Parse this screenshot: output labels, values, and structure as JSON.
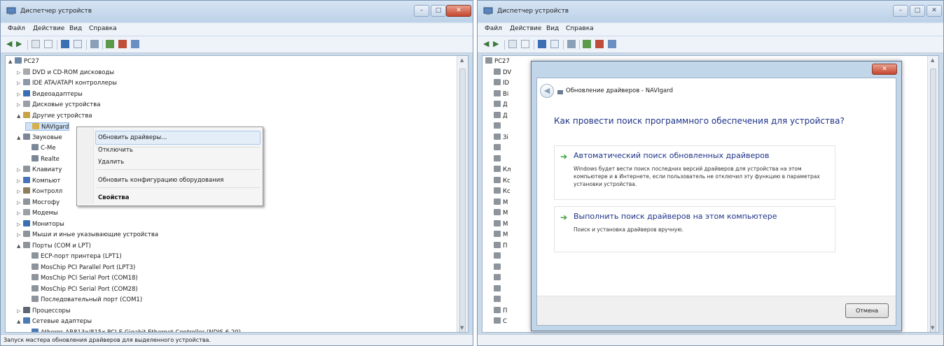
{
  "left_window": {
    "title": "Диспетчер устройств",
    "menu": [
      "Файл",
      "Действие",
      "Вид",
      "Справка"
    ],
    "status_text": "Запуск мастера обновления драйверов для выделенного устройства.",
    "tree": [
      {
        "label": "PC27",
        "level": 0,
        "expander": "▲",
        "icon_color": "#6c87a8"
      },
      {
        "label": "DVD и CD-ROM дисководы",
        "level": 1,
        "expander": "▷",
        "icon_color": "#a7a9ac"
      },
      {
        "label": "IDE ATA/ATAPI контроллеры",
        "level": 1,
        "expander": "▷",
        "icon_color": "#8c98a6"
      },
      {
        "label": "Видеоадаптеры",
        "level": 1,
        "expander": "▷",
        "icon_color": "#3b6fb4"
      },
      {
        "label": "Дисковые устройства",
        "level": 1,
        "expander": "▷",
        "icon_color": "#9a9fa6"
      },
      {
        "label": "Другие устройства",
        "level": 1,
        "expander": "▲",
        "icon_color": "#c9a24a"
      },
      {
        "label": "NAVIgard",
        "level": 2,
        "expander": "",
        "icon_color": "#d6b04b"
      },
      {
        "label": "Звуковые",
        "level": 1,
        "expander": "▲",
        "icon_color": "#7b8796"
      },
      {
        "label": "C-Me",
        "level": 2,
        "expander": "",
        "icon_color": "#7b8796"
      },
      {
        "label": "Realte",
        "level": 2,
        "expander": "",
        "icon_color": "#7b8796"
      },
      {
        "label": "Клавиату",
        "level": 1,
        "expander": "▷",
        "icon_color": "#8e949b"
      },
      {
        "label": "Компьют",
        "level": 1,
        "expander": "▷",
        "icon_color": "#4873b8"
      },
      {
        "label": "Контролл",
        "level": 1,
        "expander": "▷",
        "icon_color": "#8e7d5e"
      },
      {
        "label": "Мосгофу",
        "level": 1,
        "expander": "▷",
        "icon_color": "#8e949b"
      },
      {
        "label": "Модемы",
        "level": 1,
        "expander": "▷",
        "icon_color": "#9aa0a7"
      },
      {
        "label": "Мониторы",
        "level": 1,
        "expander": "▷",
        "icon_color": "#3b6fb4"
      },
      {
        "label": "Мыши и иные указывающие устройства",
        "level": 1,
        "expander": "▷",
        "icon_color": "#8e949b"
      },
      {
        "label": "Порты (COM и LPT)",
        "level": 1,
        "expander": "▲",
        "icon_color": "#8e949b"
      },
      {
        "label": "ECP-порт принтера (LPT1)",
        "level": 2,
        "expander": "",
        "icon_color": "#8e949b"
      },
      {
        "label": "MosChip PCI Parallel Port (LPT3)",
        "level": 2,
        "expander": "",
        "icon_color": "#8e949b"
      },
      {
        "label": "MosChip PCI Serial Port (COM18)",
        "level": 2,
        "expander": "",
        "icon_color": "#8e949b"
      },
      {
        "label": "MosChip PCI Serial Port (COM28)",
        "level": 2,
        "expander": "",
        "icon_color": "#8e949b"
      },
      {
        "label": "Последовательный порт (COM1)",
        "level": 2,
        "expander": "",
        "icon_color": "#8e949b"
      },
      {
        "label": "Процессоры",
        "level": 1,
        "expander": "▷",
        "icon_color": "#5d6774"
      },
      {
        "label": "Сетевые адаптеры",
        "level": 1,
        "expander": "▲",
        "icon_color": "#4c7ab5"
      },
      {
        "label": "Atheros AR813x/815x PCI-E Gigabit Ethernet Controller (NDIS 6.20)",
        "level": 2,
        "expander": "",
        "icon_color": "#4c7ab5"
      }
    ],
    "context_menu": {
      "update_drivers": "Обновить драйверы...",
      "disable": "Отключить",
      "delete": "Удалить",
      "scan_hardware": "Обновить конфигурацию оборудования",
      "properties": "Свойства"
    }
  },
  "right_window": {
    "title": "Диспетчер устройств",
    "menu": [
      "Файл",
      "Действие",
      "Вид",
      "Справка"
    ],
    "tree_stubs": [
      "PC27",
      "DV",
      "ID",
      "Ві",
      "Д",
      "Д",
      "",
      "Зі",
      "",
      "",
      "Кл",
      "Кс",
      "Кс",
      "М",
      "М",
      "М",
      "М",
      "П",
      "",
      "",
      "",
      "",
      "",
      "П",
      "С"
    ],
    "dialog": {
      "title": "Обновление драйверов - NAVIgard",
      "heading": "Как провести поиск программного обеспечения для устройства?",
      "option_auto_title": "Автоматический поиск обновленных драйверов",
      "option_auto_desc": "Windows будет вести поиск последних версий драйверов для устройства на этом компьютере и в Интернете, если пользователь не отключил эту функцию в параметрах установки устройства.",
      "option_manual_title": "Выполнить поиск драйверов на этом компьютере",
      "option_manual_desc": "Поиск и установка драйверов вручную.",
      "cancel": "Отмена"
    }
  },
  "colors": {
    "accent_text": "#1e3287",
    "option_arrow": "#2f9b2f",
    "window_frame": "#c9daea"
  },
  "icons": [
    "device-manager-icon",
    "back-arrow-icon",
    "forward-arrow-icon",
    "green-arrow-icon",
    "close-icon",
    "minimize-icon",
    "maximize-icon"
  ]
}
